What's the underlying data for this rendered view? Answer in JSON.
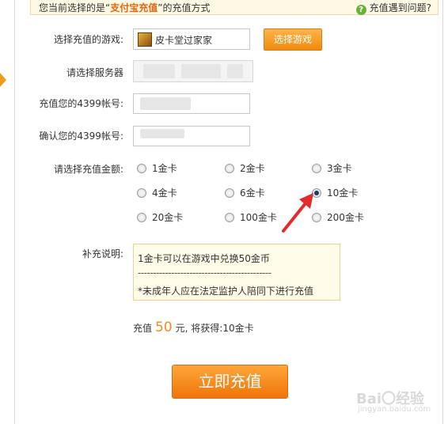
{
  "topbar": {
    "prefix": "您当前选择的是“",
    "method": "支付宝充值",
    "suffix": "”的充值方式",
    "help_text": "充值遇到问题?",
    "help_icon": "help-icon"
  },
  "form": {
    "game_label": "选择充值的游戏:",
    "game_name": "皮卡堂过家家",
    "choose_game_button": "选择游戏",
    "server_label": "请选择服务器",
    "account_label": "充值您的4399帐号:",
    "confirm_label": "确认您的4399帐号:",
    "amount_label": "请选择充值金额:",
    "options": [
      {
        "label": "1金卡",
        "checked": false
      },
      {
        "label": "2金卡",
        "checked": false
      },
      {
        "label": "3金卡",
        "checked": false
      },
      {
        "label": "4金卡",
        "checked": false
      },
      {
        "label": "6金卡",
        "checked": false
      },
      {
        "label": "10金卡",
        "checked": true
      },
      {
        "label": "20金卡",
        "checked": false
      },
      {
        "label": "100金卡",
        "checked": false
      },
      {
        "label": "200金卡",
        "checked": false
      }
    ],
    "note_label": "补充说明:",
    "note_line1": "1金卡可以在游戏中兑换50金币",
    "note_separator": "--------------------------------------------",
    "note_line3": "*未成年人应在法定监护人陪同下进行充值",
    "summary_prefix": "充值",
    "summary_amount": "50",
    "summary_suffix": "元, 将获得:10金卡",
    "submit_button": "立即充值"
  },
  "watermark": {
    "main": "Bai〇经验",
    "sub": "jingyan.baidu.com"
  },
  "colors": {
    "accent": "#f07408",
    "highlight": "#e8640c",
    "note_bg": "#fffbe8"
  }
}
